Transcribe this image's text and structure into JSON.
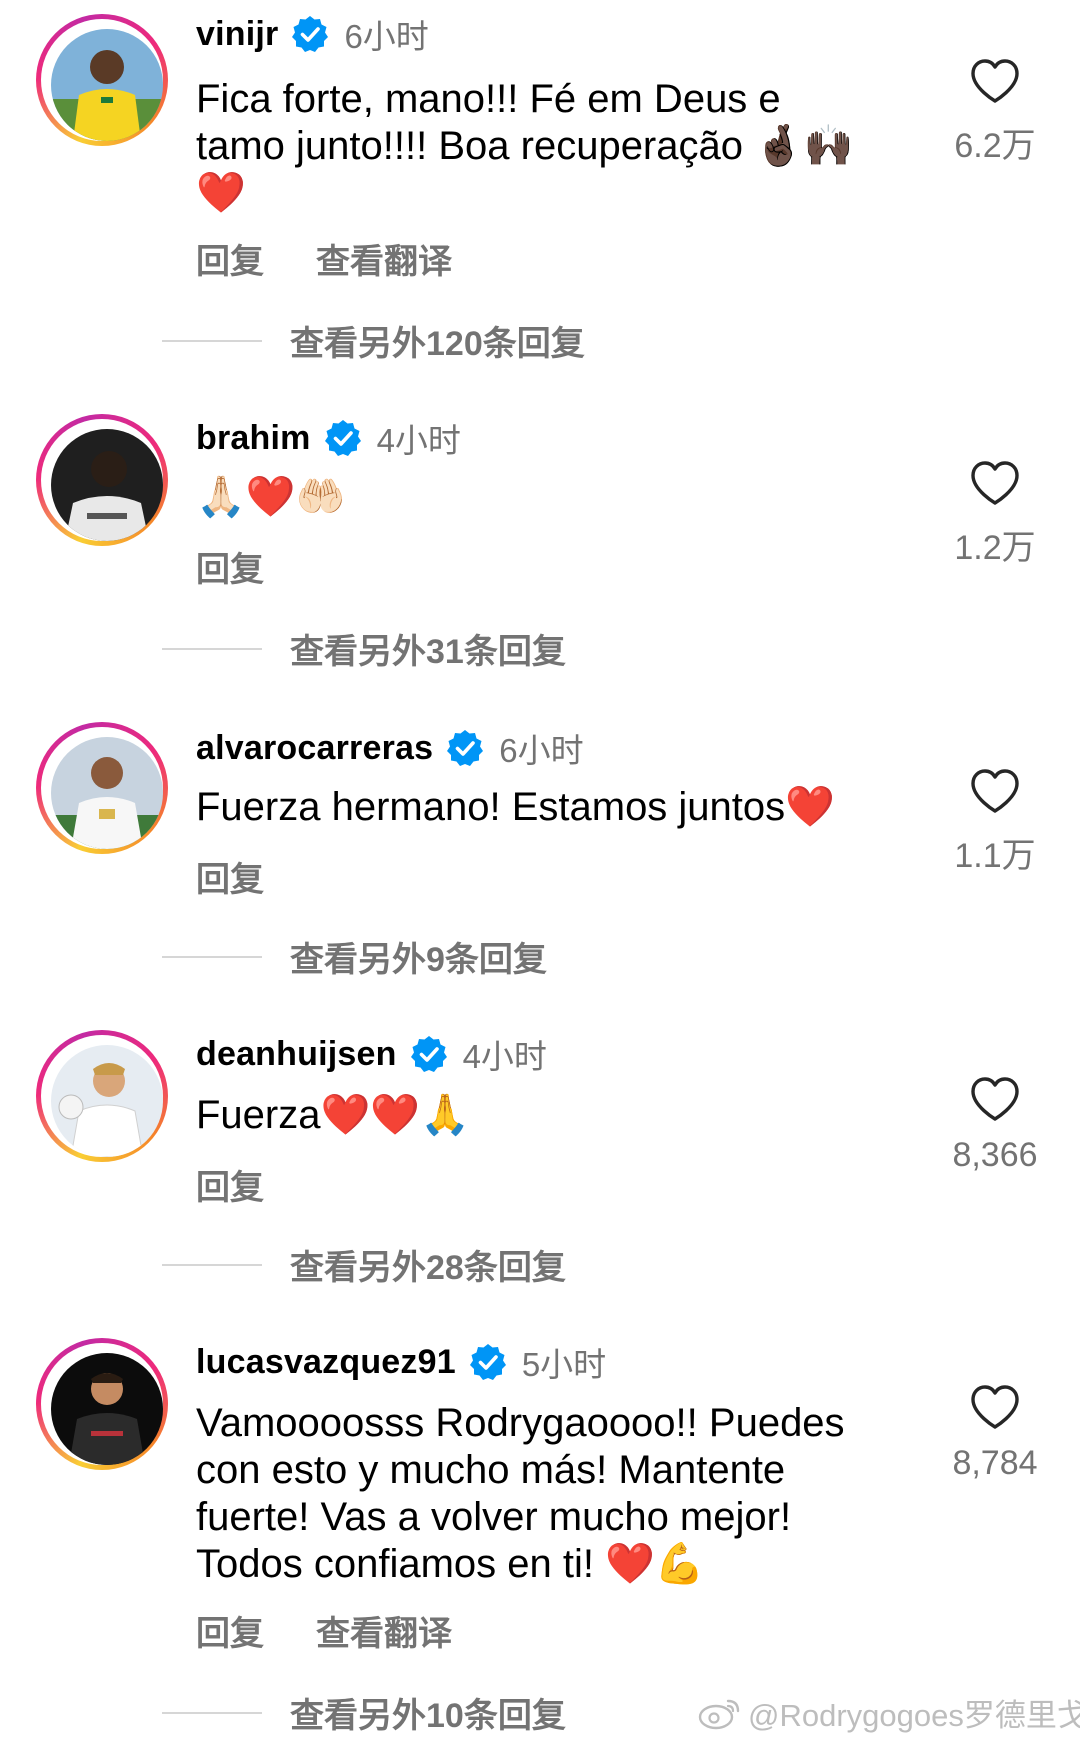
{
  "comments": [
    {
      "username": "vinijr",
      "time": "6小时",
      "text_lines": [
        "Fica forte, mano!!! Fé em Deus e",
        "tamo junto!!!! Boa recuperação 🤞🏿🙌🏿",
        "❤️"
      ],
      "actions": [
        "回复",
        "查看翻译"
      ],
      "likes": "6.2万",
      "view_replies": "查看另外120条回复",
      "avatar": "player-yellow-jersey"
    },
    {
      "username": "brahim",
      "time": "4小时",
      "text_lines": [
        "🙏🏻❤️🤲🏻"
      ],
      "actions": [
        "回复"
      ],
      "likes": "1.2万",
      "view_replies": "查看另外31条回复",
      "avatar": "player-back-view"
    },
    {
      "username": "alvarocarreras",
      "time": "6小时",
      "text_lines": [
        "Fuerza hermano! Estamos juntos❤️"
      ],
      "actions": [
        "回复"
      ],
      "likes": "1.1万",
      "view_replies": "查看另外9条回复",
      "avatar": "player-white-jersey"
    },
    {
      "username": "deanhuijsen",
      "time": "4小时",
      "text_lines": [
        "Fuerza❤️❤️🙏"
      ],
      "actions": [
        "回复"
      ],
      "likes": "8,366",
      "view_replies": "查看另外28条回复",
      "avatar": "player-white-jersey-emirates"
    },
    {
      "username": "lucasvazquez91",
      "time": "5小时",
      "text_lines": [
        "Vamoooosss Rodrygaoooo!! Puedes",
        "con esto y mucho más! Mantente",
        "fuerte! Vas a volver mucho mejor!",
        "Todos confiamos en ti! ❤️💪"
      ],
      "actions": [
        "回复",
        "查看翻译"
      ],
      "likes": "8,784",
      "view_replies": "查看另外10条回复",
      "avatar": "player-dark-jersey"
    }
  ],
  "icons": {
    "verified": "verified-badge-icon",
    "like": "heart-outline-icon",
    "watermark": "weibo-logo-icon"
  },
  "colors": {
    "verified_blue": "#0095f6",
    "secondary_text": "#737373",
    "divider": "#d6d6d6"
  },
  "watermark": "@Rodrygogoes罗德里戈"
}
